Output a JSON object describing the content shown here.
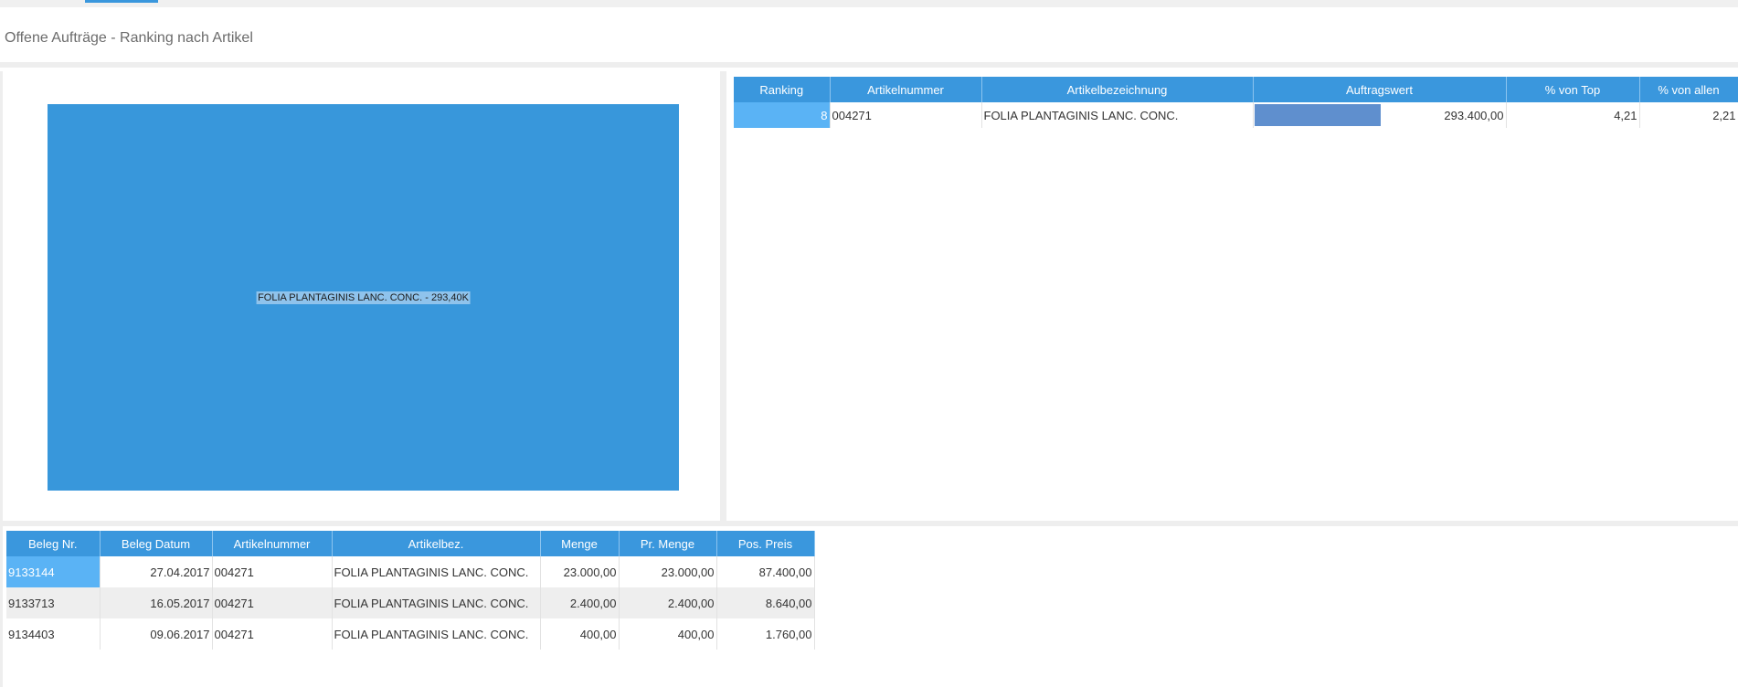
{
  "page": {
    "title": "Offene Aufträge - Ranking nach Artikel"
  },
  "treemap": {
    "label": "FOLIA PLANTAGINIS LANC. CONC. - 293,40K",
    "color": "#3897db"
  },
  "ranking": {
    "headers": [
      "Ranking",
      "Artikelnummer",
      "Artikelbezeichnung",
      "Auftragswert",
      "% von Top",
      "% von allen"
    ],
    "rows": [
      {
        "rank": "8",
        "artikelnummer": "004271",
        "bezeichnung": "FOLIA PLANTAGINIS LANC. CONC.",
        "auftragswert": "293.400,00",
        "bar_fraction": 0.5,
        "pct_top": "4,21",
        "pct_all": "2,21"
      }
    ]
  },
  "details": {
    "headers": [
      "Beleg Nr.",
      "Beleg Datum",
      "Artikelnummer",
      "Artikelbez.",
      "Menge",
      "Pr. Menge",
      "Pos. Preis"
    ],
    "rows": [
      {
        "beleg_nr": "9133144",
        "datum": "27.04.2017",
        "artikelnummer": "004271",
        "bez": "FOLIA PLANTAGINIS LANC. CONC.",
        "menge": "23.000,00",
        "pr_menge": "23.000,00",
        "preis": "87.400,00"
      },
      {
        "beleg_nr": "9133713",
        "datum": "16.05.2017",
        "artikelnummer": "004271",
        "bez": "FOLIA PLANTAGINIS LANC. CONC.",
        "menge": "2.400,00",
        "pr_menge": "2.400,00",
        "preis": "8.640,00"
      },
      {
        "beleg_nr": "9134403",
        "datum": "09.06.2017",
        "artikelnummer": "004271",
        "bez": "FOLIA PLANTAGINIS LANC. CONC.",
        "menge": "400,00",
        "pr_menge": "400,00",
        "preis": "1.760,00"
      }
    ]
  },
  "colors": {
    "accent": "#3a97dd",
    "selected": "#5ab3f5",
    "bar": "#5f8fce"
  }
}
